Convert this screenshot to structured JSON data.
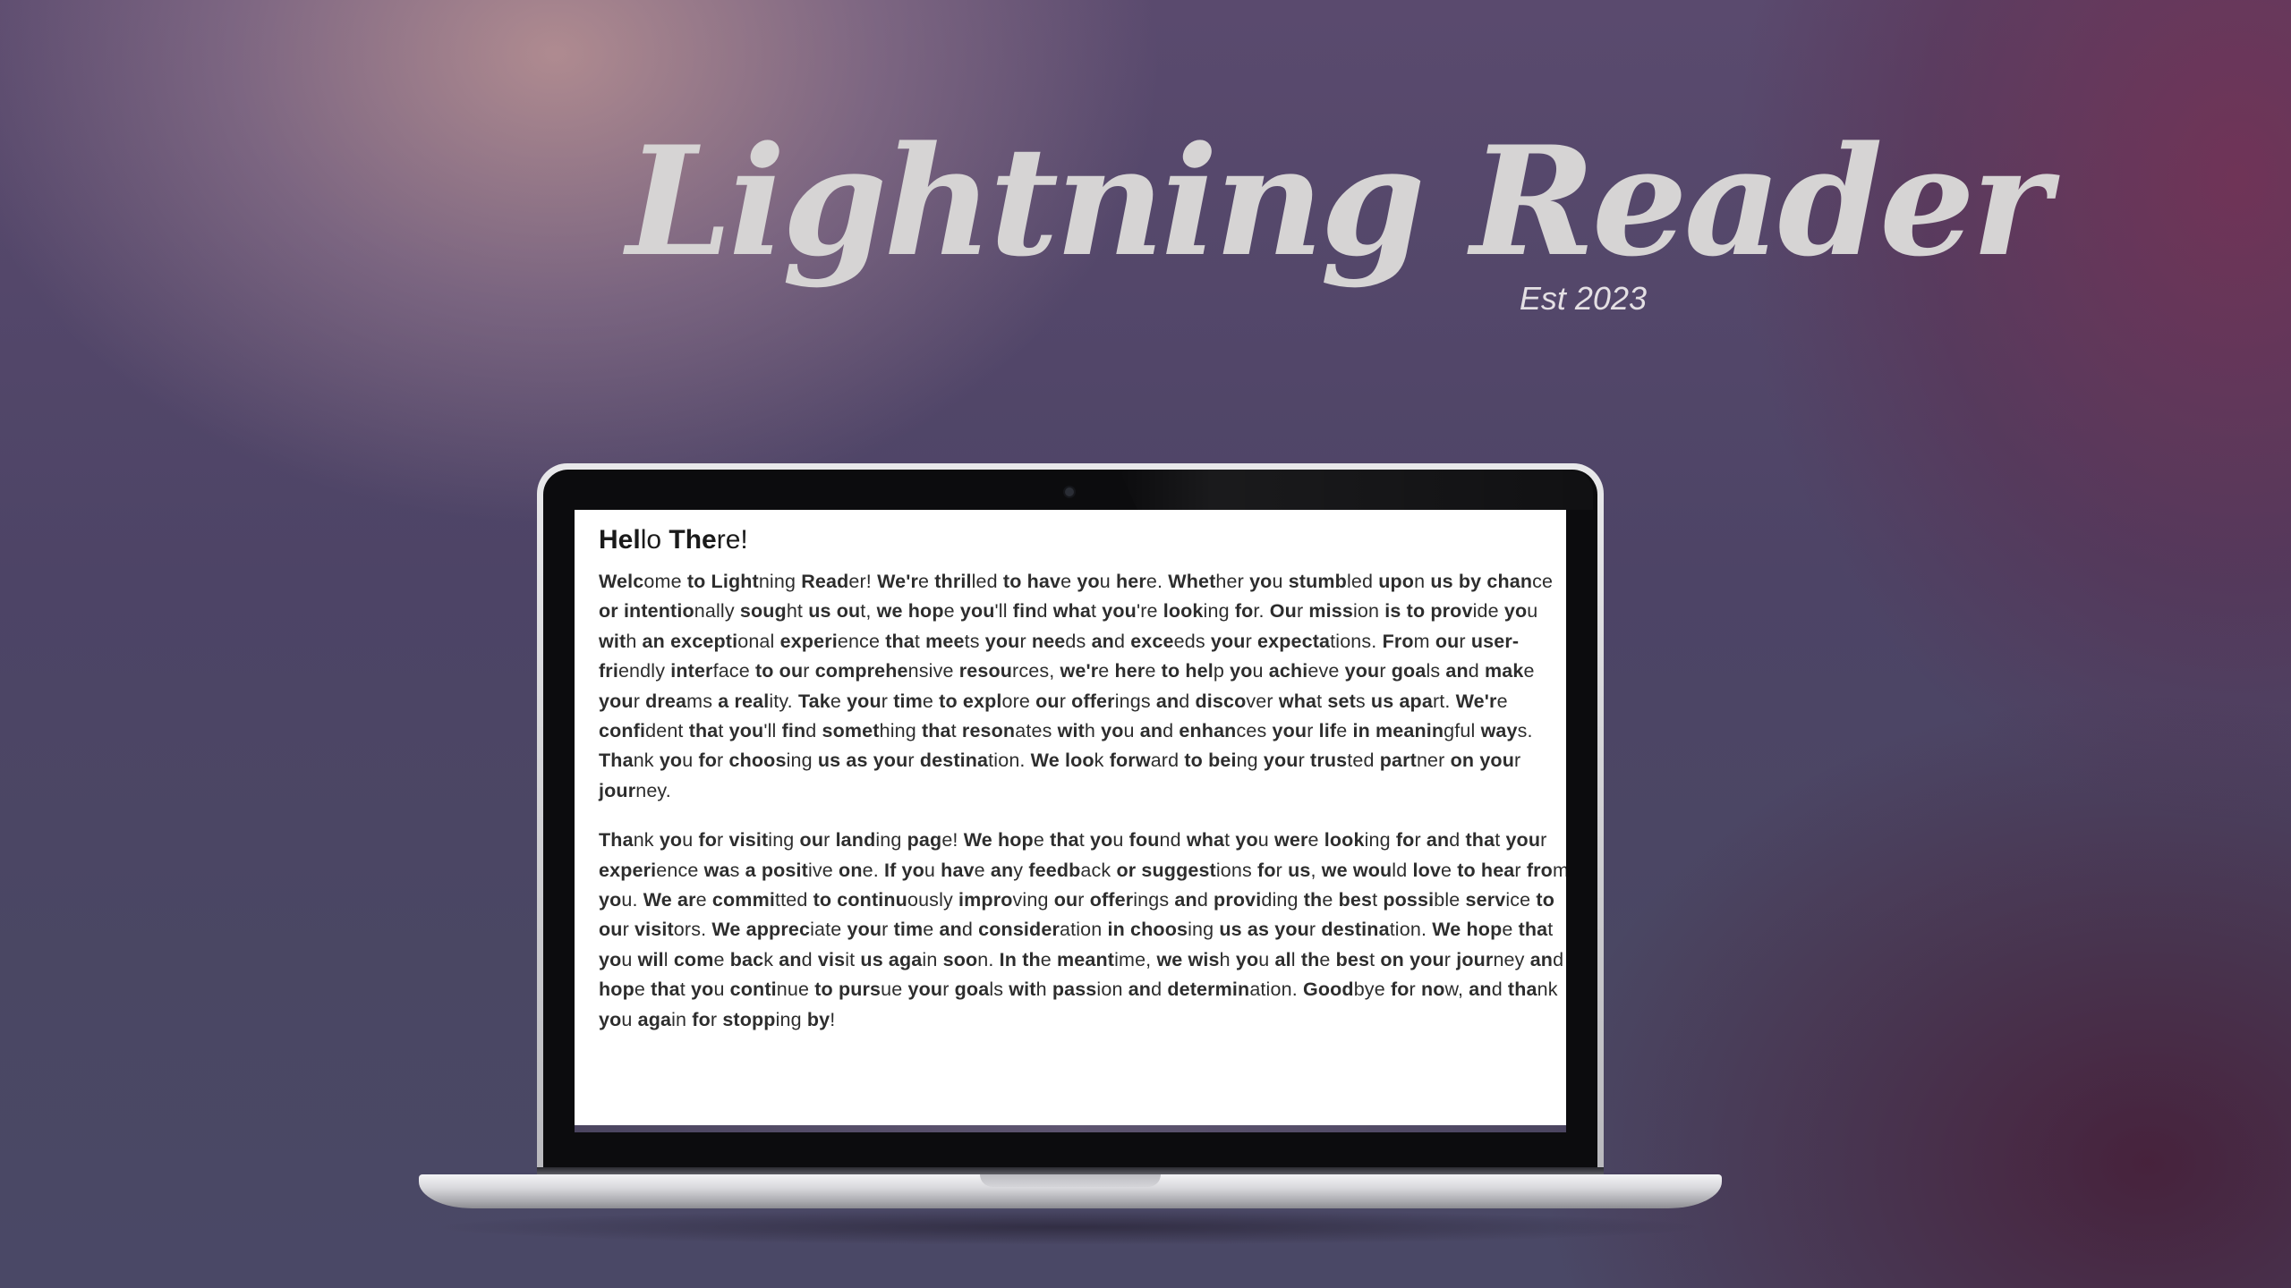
{
  "brand": {
    "title": "Lightning Reader",
    "subtitle": "Est 2023"
  },
  "article": {
    "heading": "Hello There!",
    "paragraphs": [
      "Welcome to Lightning Reader! We're thrilled to have you here. Whether you stumbled upon us by chance or intentionally sought us out, we hope you'll find what you're looking for. Our mission is to provide you with an exceptional experience that meets your needs and exceeds your expectations. From our user-friendly interface to our comprehensive resources, we're here to help you achieve your goals and make your dreams a reality. Take your time to explore our offerings and discover what sets us apart. We're confident that you'll find something that resonates with you and enhances your life in meaningful ways. Thank you for choosing us as your destination. We look forward to being your trusted partner on your journey.",
      "Thank you for visiting our landing page! We hope that you found what you were looking for and that your experience was a positive one. If you have any feedback or suggestions for us, we would love to hear from you. We are committed to continuously improving our offerings and providing the best possible service to our visitors. We appreciate your time and consideration in choosing us as your destination. We hope that you will come back and visit us again soon. In the meantime, we wish you all the best on your journey and hope that you continue to pursue your goals with passion and determination. Goodbye for now, and thank you again for stopping by!"
    ]
  }
}
